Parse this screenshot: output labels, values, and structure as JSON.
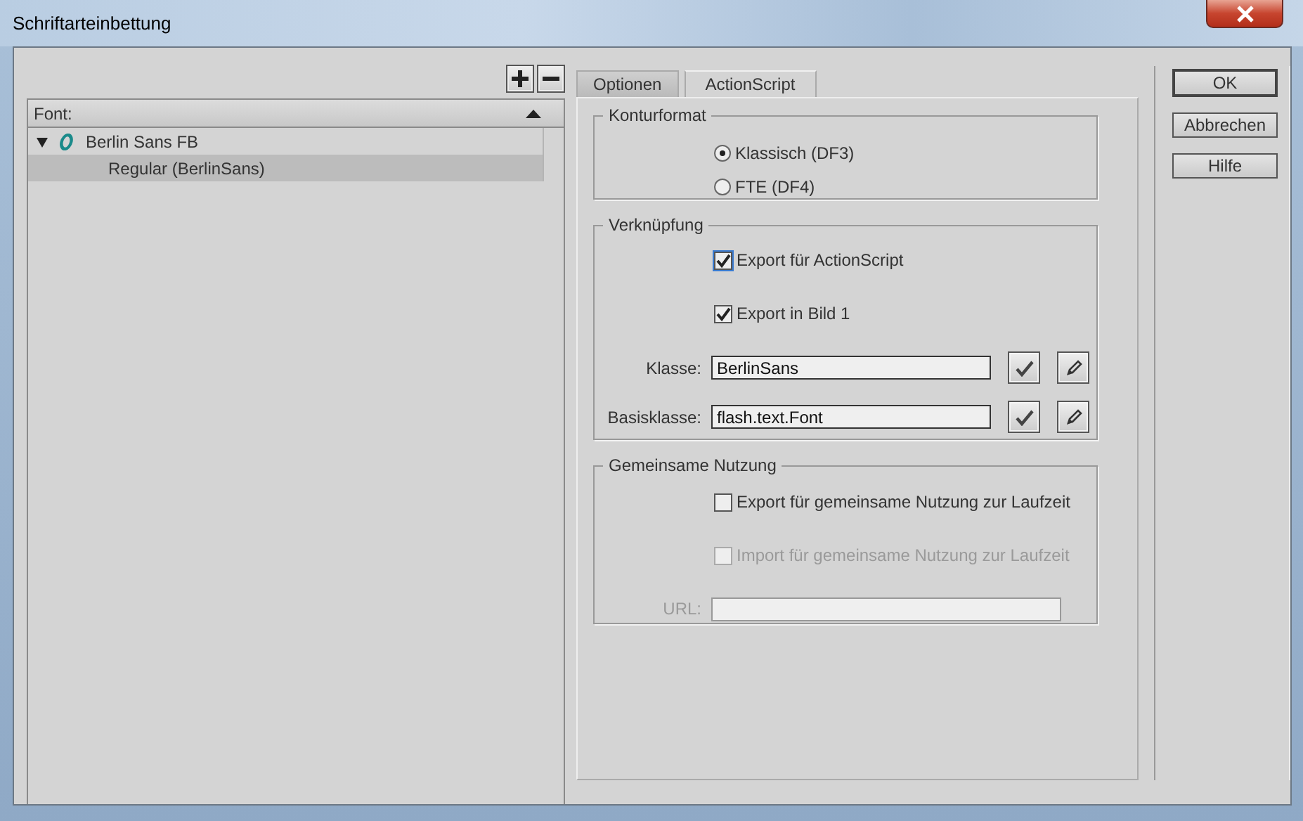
{
  "window": {
    "title": "Schriftarteinbettung"
  },
  "font_list": {
    "header": "Font:",
    "items": [
      {
        "label": "Berlin Sans FB",
        "expanded": true,
        "selected": false,
        "children": [
          {
            "label": "Regular (BerlinSans)",
            "selected": true
          }
        ]
      }
    ]
  },
  "tabs": [
    {
      "label": "Optionen",
      "selected": false
    },
    {
      "label": "ActionScript",
      "selected": true
    }
  ],
  "konturformat": {
    "title": "Konturformat",
    "options": [
      {
        "label": "Klassisch (DF3)",
        "selected": true
      },
      {
        "label": "FTE (DF4)",
        "selected": false
      }
    ]
  },
  "verknuepfung": {
    "title": "Verknüpfung",
    "checkboxes": [
      {
        "label": "Export für ActionScript",
        "checked": true,
        "focused": true
      },
      {
        "label": "Export in Bild 1",
        "checked": true,
        "focused": false
      }
    ],
    "fields": [
      {
        "label": "Klasse:",
        "value": "BerlinSans"
      },
      {
        "label": "Basisklasse:",
        "value": "flash.text.Font"
      }
    ]
  },
  "gemeinsame_nutzung": {
    "title": "Gemeinsame Nutzung",
    "checkboxes": [
      {
        "label": "Export für gemeinsame Nutzung zur Laufzeit",
        "checked": false,
        "disabled": false
      },
      {
        "label": "Import für gemeinsame Nutzung zur Laufzeit",
        "checked": false,
        "disabled": true
      }
    ],
    "url": {
      "label": "URL:",
      "disabled": true
    }
  },
  "buttons": [
    {
      "label": "OK",
      "default": true
    },
    {
      "label": "Abbrechen",
      "default": false
    },
    {
      "label": "Hilfe",
      "default": false
    }
  ]
}
